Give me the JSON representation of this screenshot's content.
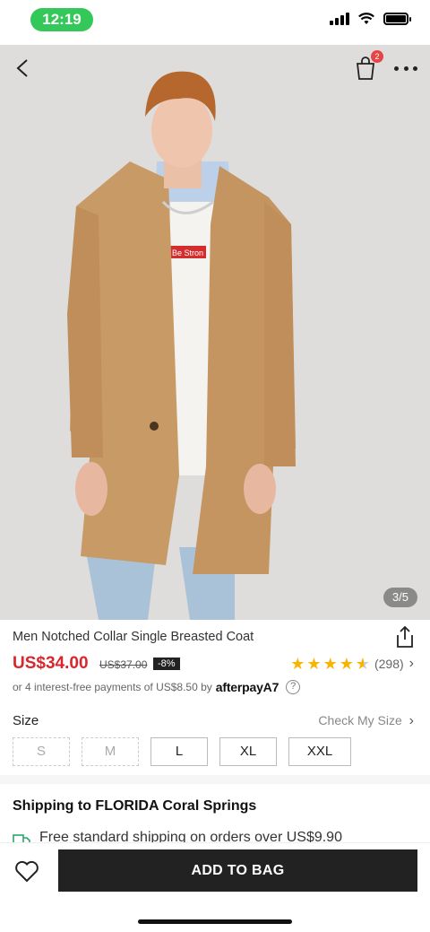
{
  "status_bar": {
    "time": "12:19"
  },
  "header": {
    "cart_count": "2"
  },
  "gallery": {
    "pager": "3/5",
    "tee_text": "Be Stron"
  },
  "product": {
    "title": "Men Notched Collar Single Breasted Coat",
    "price": "US$34.00",
    "original_price": "US$37.00",
    "discount": "-8%",
    "rating_value": 4.5,
    "review_count": "(298)",
    "installments_text": "or 4 interest-free payments of US$8.50 by",
    "afterpay_label": "afterpay",
    "afterpay_mark": "A7"
  },
  "size": {
    "label": "Size",
    "check_label": "Check My Size",
    "options": [
      {
        "label": "S",
        "available": false
      },
      {
        "label": "M",
        "available": false
      },
      {
        "label": "L",
        "available": true
      },
      {
        "label": "XL",
        "available": true
      },
      {
        "label": "XXL",
        "available": true
      }
    ]
  },
  "shipping": {
    "title": "Shipping to FLORIDA Coral Springs",
    "free_text": "Free standard shipping on orders over US$9.90"
  },
  "bottom": {
    "add_to_bag": "ADD TO BAG"
  },
  "colors": {
    "price": "#d9262c",
    "star": "#f8b400",
    "button": "#222222",
    "time_pill": "#34c759"
  },
  "icons": [
    "back-icon",
    "shopping-bag-icon",
    "more-icon",
    "share-icon",
    "star-icon",
    "info-icon",
    "chevron-right-icon",
    "truck-icon",
    "heart-icon"
  ]
}
